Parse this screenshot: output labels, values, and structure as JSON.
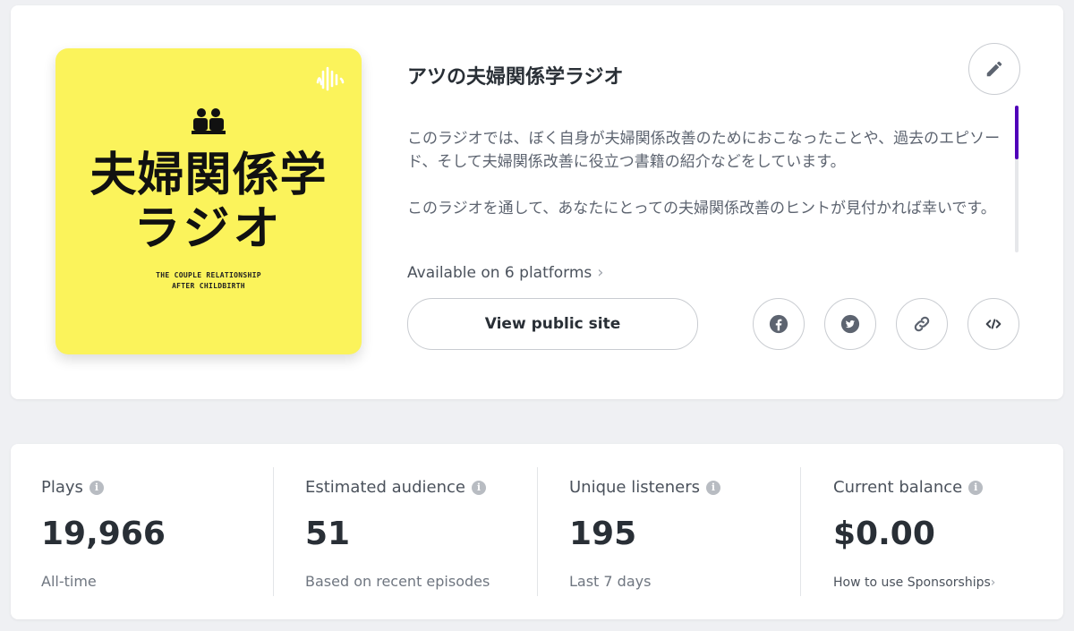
{
  "show": {
    "title": "アツの夫婦関係学ラジオ",
    "description": "このラジオでは、ぼく自身が夫婦関係改善のためにおこなったことや、過去のエピソード、そして夫婦関係改善に役立つ書籍の紹介などをしています。\n\nこのラジオを通して、あなたにとっての夫婦関係改善のヒントが見付かれば幸いです。",
    "platforms_label": "Available on 6 platforms",
    "view_site_label": "View public site"
  },
  "cover": {
    "title_line1": "夫婦関係学",
    "title_line2": "ラジオ",
    "subtitle_line1": "THE COUPLE RELATIONSHIP",
    "subtitle_line2": "AFTER CHILDBIRTH",
    "background": "#fbf35b"
  },
  "share": {
    "icons": [
      "facebook-icon",
      "twitter-icon",
      "link-icon",
      "embed-code-icon"
    ]
  },
  "stats": [
    {
      "label": "Plays",
      "value": "19,966",
      "note": "All-time"
    },
    {
      "label": "Estimated audience",
      "value": "51",
      "note": "Based on recent episodes"
    },
    {
      "label": "Unique listeners",
      "value": "195",
      "note": "Last 7 days"
    },
    {
      "label": "Current balance",
      "value": "$0.00",
      "note": "How to use Sponsorships"
    }
  ],
  "colors": {
    "accent": "#5000b9",
    "background": "#eff0f3",
    "text": "#292f36"
  }
}
